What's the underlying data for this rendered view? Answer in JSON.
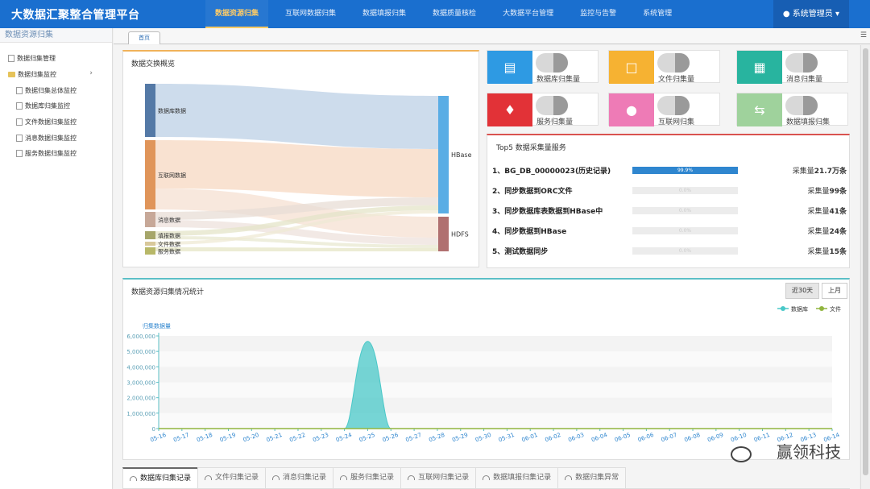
{
  "app": {
    "title": "大数据汇聚整合管理平台",
    "user": "系统管理员"
  },
  "nav": [
    {
      "label": "数据资源归集",
      "active": true
    },
    {
      "label": "互联网数据归集"
    },
    {
      "label": "数据填报归集"
    },
    {
      "label": "数据质量核检"
    },
    {
      "label": "大数据平台管理"
    },
    {
      "label": "监控与告警"
    },
    {
      "label": "系统管理"
    }
  ],
  "sidebar": {
    "title": "数据资源归集",
    "items": [
      {
        "label": "数据归集管理"
      },
      {
        "label": "数据归集监控",
        "expanded": true
      },
      {
        "label": "数据归集总体监控"
      },
      {
        "label": "数据库归集监控"
      },
      {
        "label": "文件数据归集监控"
      },
      {
        "label": "消息数据归集监控"
      },
      {
        "label": "服务数据归集监控"
      }
    ]
  },
  "tabs": {
    "home": "首页"
  },
  "sankey": {
    "title": "数据交换概览",
    "sources": [
      "数据库数据",
      "互联网数据",
      "消息数据",
      "填报数据",
      "文件数据",
      "服务数据"
    ],
    "targets": [
      "HBase",
      "HDFS"
    ]
  },
  "cards": [
    {
      "label": "数据库归集量",
      "color": "#2e9ae3",
      "icon": "inbox-icon"
    },
    {
      "label": "文件归集量",
      "color": "#f6b232",
      "icon": "file-icon"
    },
    {
      "label": "消息归集量",
      "color": "#28b49f",
      "icon": "book-icon"
    },
    {
      "label": "服务归集量",
      "color": "#e23237",
      "icon": "fire-icon"
    },
    {
      "label": "互联网归集",
      "color": "#ee7bb6",
      "icon": "globe-icon"
    },
    {
      "label": "数据填报归集",
      "color": "#9fd29c",
      "icon": "exchange-icon"
    }
  ],
  "top5": {
    "title": "Top5 数据采集量服务",
    "rows": [
      {
        "name": "1、BG_DB_00000023(历史记录)",
        "pct": "99.9%",
        "fill": 0.999,
        "prefix": "采集量",
        "value": "21.7万条"
      },
      {
        "name": "2、同步数据到ORC文件",
        "pct": "0.0%",
        "fill": 0,
        "prefix": "采集量",
        "value": "99条"
      },
      {
        "name": "3、同步数据库表数据到HBase中",
        "pct": "0.0%",
        "fill": 0,
        "prefix": "采集量",
        "value": "41条"
      },
      {
        "name": "4、同步数据到HBase",
        "pct": "0.0%",
        "fill": 0,
        "prefix": "采集量",
        "value": "24条"
      },
      {
        "name": "5、测试数据同步",
        "pct": "0.0%",
        "fill": 0,
        "prefix": "采集量",
        "value": "15条"
      }
    ]
  },
  "linechart": {
    "title": "数据资源归集情况统计",
    "buttons": [
      {
        "label": "近30天",
        "active": true
      },
      {
        "label": "上月"
      }
    ]
  },
  "chart_data": {
    "type": "area",
    "title": "",
    "ylabel": "归集数据量",
    "ylim": [
      0,
      6000000
    ],
    "yticks": [
      "0",
      "1,000,000",
      "2,000,000",
      "3,000,000",
      "4,000,000",
      "5,000,000",
      "6,000,000"
    ],
    "categories": [
      "05-16",
      "05-17",
      "05-18",
      "05-19",
      "05-20",
      "05-21",
      "05-22",
      "05-23",
      "05-24",
      "05-25",
      "05-26",
      "05-27",
      "05-28",
      "05-29",
      "05-30",
      "05-31",
      "06-01",
      "06-02",
      "06-03",
      "06-04",
      "06-05",
      "06-06",
      "06-07",
      "06-08",
      "06-09",
      "06-10",
      "06-11",
      "06-12",
      "06-13",
      "06-14"
    ],
    "series": [
      {
        "name": "数据库",
        "color": "#49c8c8",
        "values": [
          0,
          0,
          0,
          0,
          0,
          0,
          0,
          0,
          0,
          5650000,
          0,
          0,
          0,
          0,
          0,
          0,
          0,
          0,
          0,
          0,
          0,
          0,
          0,
          0,
          0,
          0,
          0,
          0,
          0,
          0
        ]
      },
      {
        "name": "文件",
        "color": "#91b53f",
        "values": [
          0,
          0,
          0,
          0,
          0,
          0,
          0,
          0,
          0,
          0,
          0,
          0,
          0,
          0,
          0,
          0,
          0,
          0,
          0,
          0,
          0,
          0,
          0,
          0,
          0,
          0,
          0,
          0,
          0,
          0
        ]
      }
    ],
    "legend": "top-right"
  },
  "bottom_tabs": [
    {
      "label": "数据库归集记录",
      "active": true
    },
    {
      "label": "文件归集记录"
    },
    {
      "label": "消息归集记录"
    },
    {
      "label": "服务归集记录"
    },
    {
      "label": "互联网归集记录"
    },
    {
      "label": "数据填报归集记录"
    },
    {
      "label": "数据归集异常"
    }
  ],
  "watermark": "赢领科技"
}
